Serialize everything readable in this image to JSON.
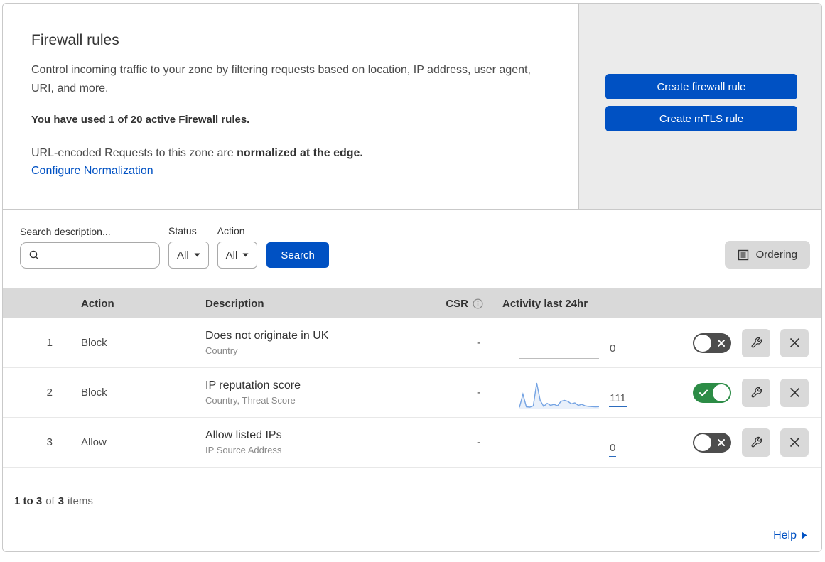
{
  "header": {
    "title": "Firewall rules",
    "description": "Control incoming traffic to your zone by filtering requests based on location, IP address, user agent, URI, and more.",
    "usage_note": "You have used 1 of 20 active Firewall rules.",
    "normalization_text": "URL-encoded Requests to this zone are",
    "normalization_bold": "normalized at the edge.",
    "normalization_link": "Configure Normalization",
    "create_firewall_button": "Create firewall rule",
    "create_mtls_button": "Create mTLS rule"
  },
  "filters": {
    "search_label": "Search description...",
    "search_value": "",
    "status_label": "Status",
    "status_value": "All",
    "action_label": "Action",
    "action_value": "All",
    "search_button": "Search",
    "ordering_button": "Ordering"
  },
  "table": {
    "columns": {
      "action": "Action",
      "description": "Description",
      "csr": "CSR",
      "activity": "Activity last 24hr"
    },
    "rows": [
      {
        "priority": "1",
        "action": "Block",
        "description": "Does not originate in UK",
        "fields": "Country",
        "csr": "-",
        "activity_count": "0",
        "enabled": false,
        "sparkline": null
      },
      {
        "priority": "2",
        "action": "Block",
        "description": "IP reputation score",
        "fields": "Country, Threat Score",
        "csr": "-",
        "activity_count": "111",
        "enabled": true,
        "sparkline": [
          2,
          55,
          4,
          3,
          8,
          100,
          30,
          6,
          18,
          10,
          14,
          8,
          26,
          30,
          26,
          16,
          20,
          10,
          14,
          8,
          6,
          5,
          4,
          5
        ]
      },
      {
        "priority": "3",
        "action": "Allow",
        "description": "Allow listed IPs",
        "fields": "IP Source Address",
        "csr": "-",
        "activity_count": "0",
        "enabled": false,
        "sparkline": null
      }
    ]
  },
  "footer": {
    "range": "1 to 3",
    "of_text": "of",
    "total": "3",
    "items_text": "items",
    "help_label": "Help"
  },
  "icons": {
    "search": "magnifier",
    "caret": "triangle-down",
    "ordering": "list-document",
    "csr_info": "info-circle",
    "toggle_off": "x-mark",
    "toggle_on": "check-mark",
    "edit": "wrench",
    "delete": "x-mark",
    "help_arrow": "triangle-right"
  },
  "colors": {
    "primary_blue": "#0051c3",
    "toggle_on_green": "#2c8c46",
    "toggle_off_gray": "#4d4d4d",
    "header_bar_gray": "#d9d9d9",
    "panel_gray": "#ebebeb",
    "sparkline_blue": "#74a3e3",
    "count_underline_blue": "#2c6cbe"
  }
}
